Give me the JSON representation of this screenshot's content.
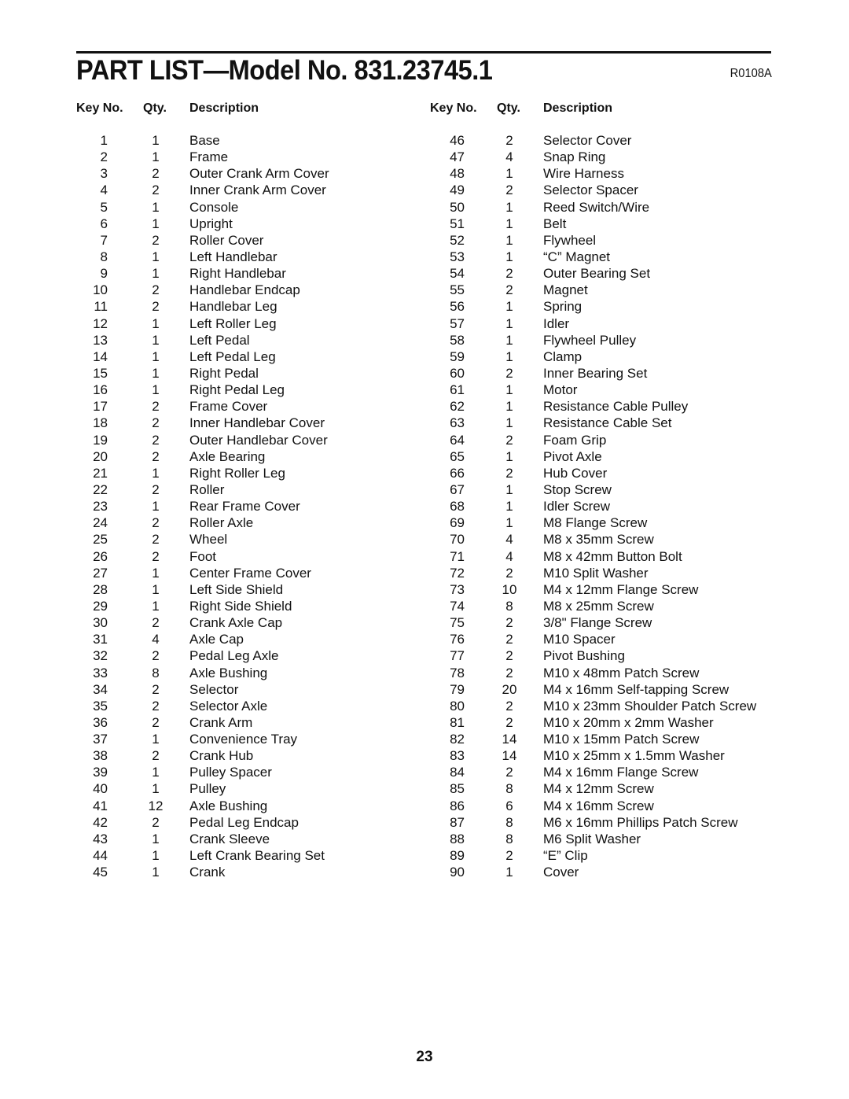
{
  "header": {
    "title": "PART LIST—Model No. 831.23745.1",
    "code": "R0108A"
  },
  "columns": {
    "key": "Key No.",
    "qty": "Qty.",
    "description": "Description"
  },
  "left_rows": [
    {
      "key": "1",
      "qty": "1",
      "desc": "Base"
    },
    {
      "key": "2",
      "qty": "1",
      "desc": "Frame"
    },
    {
      "key": "3",
      "qty": "2",
      "desc": "Outer Crank Arm Cover"
    },
    {
      "key": "4",
      "qty": "2",
      "desc": "Inner Crank Arm Cover"
    },
    {
      "key": "5",
      "qty": "1",
      "desc": "Console"
    },
    {
      "key": "6",
      "qty": "1",
      "desc": "Upright"
    },
    {
      "key": "7",
      "qty": "2",
      "desc": "Roller Cover"
    },
    {
      "key": "8",
      "qty": "1",
      "desc": "Left Handlebar"
    },
    {
      "key": "9",
      "qty": "1",
      "desc": "Right Handlebar"
    },
    {
      "key": "10",
      "qty": "2",
      "desc": "Handlebar Endcap"
    },
    {
      "key": "11",
      "qty": "2",
      "desc": "Handlebar Leg"
    },
    {
      "key": "12",
      "qty": "1",
      "desc": "Left Roller Leg"
    },
    {
      "key": "13",
      "qty": "1",
      "desc": "Left Pedal"
    },
    {
      "key": "14",
      "qty": "1",
      "desc": "Left Pedal Leg"
    },
    {
      "key": "15",
      "qty": "1",
      "desc": "Right Pedal"
    },
    {
      "key": "16",
      "qty": "1",
      "desc": "Right Pedal Leg"
    },
    {
      "key": "17",
      "qty": "2",
      "desc": "Frame Cover"
    },
    {
      "key": "18",
      "qty": "2",
      "desc": "Inner Handlebar Cover"
    },
    {
      "key": "19",
      "qty": "2",
      "desc": "Outer Handlebar Cover"
    },
    {
      "key": "20",
      "qty": "2",
      "desc": "Axle Bearing"
    },
    {
      "key": "21",
      "qty": "1",
      "desc": "Right Roller Leg"
    },
    {
      "key": "22",
      "qty": "2",
      "desc": "Roller"
    },
    {
      "key": "23",
      "qty": "1",
      "desc": "Rear Frame Cover"
    },
    {
      "key": "24",
      "qty": "2",
      "desc": "Roller Axle"
    },
    {
      "key": "25",
      "qty": "2",
      "desc": "Wheel"
    },
    {
      "key": "26",
      "qty": "2",
      "desc": "Foot"
    },
    {
      "key": "27",
      "qty": "1",
      "desc": "Center Frame Cover"
    },
    {
      "key": "28",
      "qty": "1",
      "desc": "Left Side Shield"
    },
    {
      "key": "29",
      "qty": "1",
      "desc": "Right Side Shield"
    },
    {
      "key": "30",
      "qty": "2",
      "desc": "Crank Axle Cap"
    },
    {
      "key": "31",
      "qty": "4",
      "desc": "Axle Cap"
    },
    {
      "key": "32",
      "qty": "2",
      "desc": "Pedal Leg Axle"
    },
    {
      "key": "33",
      "qty": "8",
      "desc": "Axle Bushing"
    },
    {
      "key": "34",
      "qty": "2",
      "desc": "Selector"
    },
    {
      "key": "35",
      "qty": "2",
      "desc": "Selector Axle"
    },
    {
      "key": "36",
      "qty": "2",
      "desc": "Crank Arm"
    },
    {
      "key": "37",
      "qty": "1",
      "desc": "Convenience Tray"
    },
    {
      "key": "38",
      "qty": "2",
      "desc": "Crank Hub"
    },
    {
      "key": "39",
      "qty": "1",
      "desc": "Pulley Spacer"
    },
    {
      "key": "40",
      "qty": "1",
      "desc": "Pulley"
    },
    {
      "key": "41",
      "qty": "12",
      "desc": "Axle Bushing"
    },
    {
      "key": "42",
      "qty": "2",
      "desc": "Pedal Leg Endcap"
    },
    {
      "key": "43",
      "qty": "1",
      "desc": "Crank Sleeve"
    },
    {
      "key": "44",
      "qty": "1",
      "desc": "Left Crank Bearing Set"
    },
    {
      "key": "45",
      "qty": "1",
      "desc": "Crank"
    }
  ],
  "right_rows": [
    {
      "key": "46",
      "qty": "2",
      "desc": "Selector Cover"
    },
    {
      "key": "47",
      "qty": "4",
      "desc": "Snap Ring"
    },
    {
      "key": "48",
      "qty": "1",
      "desc": "Wire Harness"
    },
    {
      "key": "49",
      "qty": "2",
      "desc": "Selector Spacer"
    },
    {
      "key": "50",
      "qty": "1",
      "desc": "Reed Switch/Wire"
    },
    {
      "key": "51",
      "qty": "1",
      "desc": "Belt"
    },
    {
      "key": "52",
      "qty": "1",
      "desc": "Flywheel"
    },
    {
      "key": "53",
      "qty": "1",
      "desc": "“C” Magnet"
    },
    {
      "key": "54",
      "qty": "2",
      "desc": "Outer Bearing Set"
    },
    {
      "key": "55",
      "qty": "2",
      "desc": "Magnet"
    },
    {
      "key": "56",
      "qty": "1",
      "desc": "Spring"
    },
    {
      "key": "57",
      "qty": "1",
      "desc": "Idler"
    },
    {
      "key": "58",
      "qty": "1",
      "desc": "Flywheel Pulley"
    },
    {
      "key": "59",
      "qty": "1",
      "desc": "Clamp"
    },
    {
      "key": "60",
      "qty": "2",
      "desc": "Inner Bearing Set"
    },
    {
      "key": "61",
      "qty": "1",
      "desc": "Motor"
    },
    {
      "key": "62",
      "qty": "1",
      "desc": "Resistance Cable Pulley"
    },
    {
      "key": "63",
      "qty": "1",
      "desc": "Resistance Cable Set"
    },
    {
      "key": "64",
      "qty": "2",
      "desc": "Foam Grip"
    },
    {
      "key": "65",
      "qty": "1",
      "desc": "Pivot Axle"
    },
    {
      "key": "66",
      "qty": "2",
      "desc": "Hub Cover"
    },
    {
      "key": "67",
      "qty": "1",
      "desc": "Stop Screw"
    },
    {
      "key": "68",
      "qty": "1",
      "desc": "Idler Screw"
    },
    {
      "key": "69",
      "qty": "1",
      "desc": "M8 Flange Screw"
    },
    {
      "key": "70",
      "qty": "4",
      "desc": "M8 x 35mm Screw"
    },
    {
      "key": "71",
      "qty": "4",
      "desc": "M8 x 42mm Button Bolt"
    },
    {
      "key": "72",
      "qty": "2",
      "desc": "M10 Split Washer"
    },
    {
      "key": "73",
      "qty": "10",
      "desc": "M4 x 12mm Flange Screw"
    },
    {
      "key": "74",
      "qty": "8",
      "desc": "M8 x 25mm Screw"
    },
    {
      "key": "75",
      "qty": "2",
      "desc": "3/8\" Flange Screw"
    },
    {
      "key": "76",
      "qty": "2",
      "desc": "M10 Spacer"
    },
    {
      "key": "77",
      "qty": "2",
      "desc": "Pivot Bushing"
    },
    {
      "key": "78",
      "qty": "2",
      "desc": "M10 x 48mm Patch Screw"
    },
    {
      "key": "79",
      "qty": "20",
      "desc": "M4 x 16mm Self-tapping Screw"
    },
    {
      "key": "80",
      "qty": "2",
      "desc": "M10 x 23mm Shoulder Patch Screw"
    },
    {
      "key": "81",
      "qty": "2",
      "desc": "M10 x 20mm x 2mm Washer"
    },
    {
      "key": "82",
      "qty": "14",
      "desc": "M10 x 15mm Patch Screw"
    },
    {
      "key": "83",
      "qty": "14",
      "desc": "M10 x 25mm x 1.5mm Washer"
    },
    {
      "key": "84",
      "qty": "2",
      "desc": "M4 x 16mm Flange Screw"
    },
    {
      "key": "85",
      "qty": "8",
      "desc": "M4 x 12mm Screw"
    },
    {
      "key": "86",
      "qty": "6",
      "desc": "M4 x 16mm Screw"
    },
    {
      "key": "87",
      "qty": "8",
      "desc": "M6 x 16mm Phillips Patch Screw"
    },
    {
      "key": "88",
      "qty": "8",
      "desc": "M6 Split Washer"
    },
    {
      "key": "89",
      "qty": "2",
      "desc": "“E” Clip"
    },
    {
      "key": "90",
      "qty": "1",
      "desc": "Cover"
    }
  ],
  "footer": {
    "page_number": "23"
  }
}
